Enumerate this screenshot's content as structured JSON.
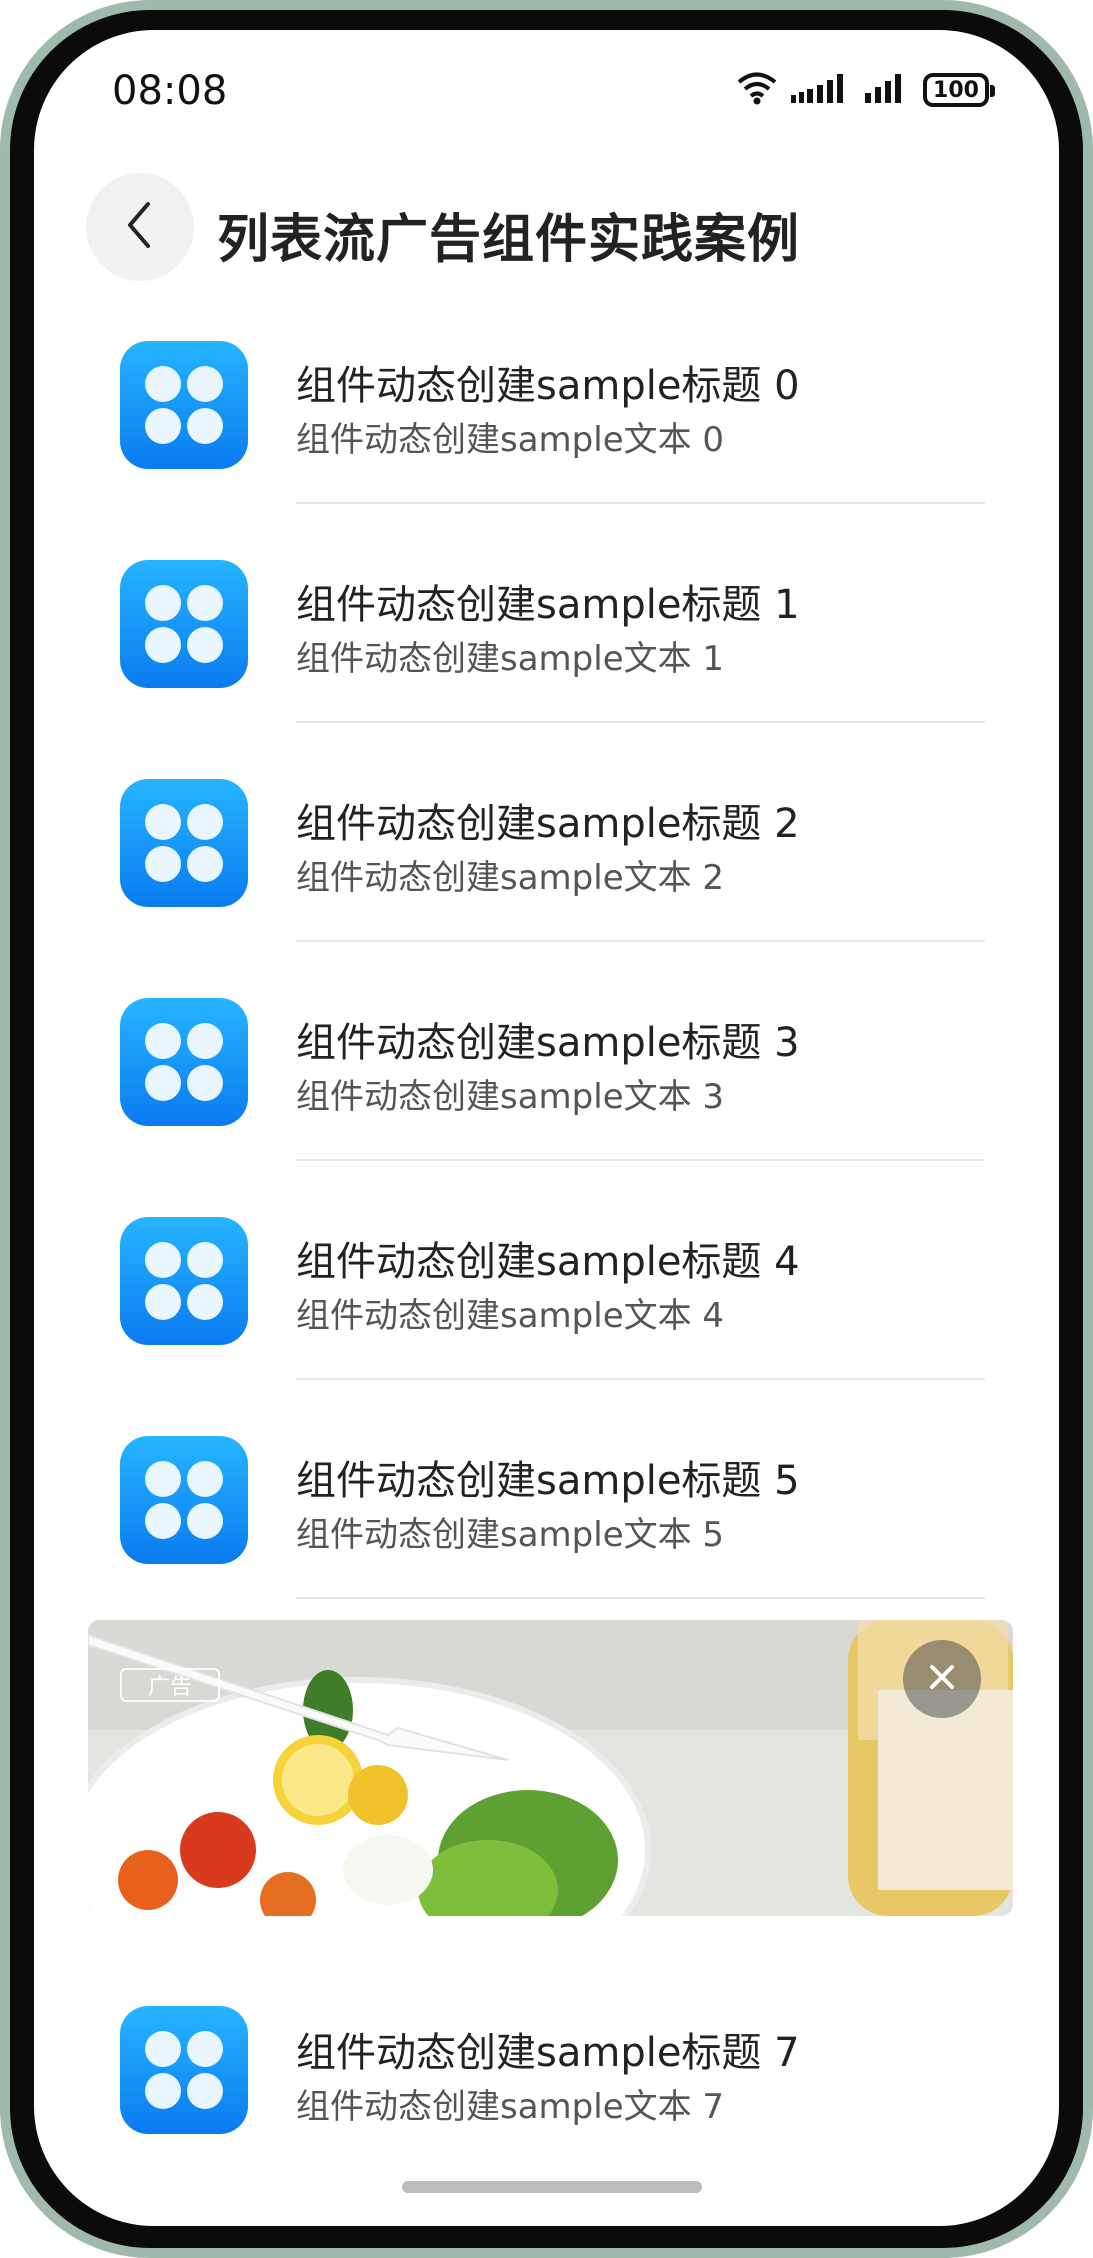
{
  "status_bar": {
    "time": "08:08",
    "battery": "100",
    "icons": [
      "wifi-icon",
      "signal-icon",
      "signal-icon",
      "battery-icon"
    ]
  },
  "header": {
    "title": "列表流广告组件实践案例",
    "back_icon": "chevron-left-icon"
  },
  "list": {
    "items_before_ad": [
      {
        "title": "组件动态创建sample标题 0",
        "subtitle": "组件动态创建sample文本 0"
      },
      {
        "title": "组件动态创建sample标题 1",
        "subtitle": "组件动态创建sample文本 1"
      },
      {
        "title": "组件动态创建sample标题 2",
        "subtitle": "组件动态创建sample文本 2"
      },
      {
        "title": "组件动态创建sample标题 3",
        "subtitle": "组件动态创建sample文本 3"
      },
      {
        "title": "组件动态创建sample标题 4",
        "subtitle": "组件动态创建sample文本 4"
      },
      {
        "title": "组件动态创建sample标题 5",
        "subtitle": "组件动态创建sample文本 5"
      }
    ],
    "items_after_ad": [
      {
        "title": "组件动态创建sample标题 7",
        "subtitle": "组件动态创建sample文本 7"
      }
    ],
    "item_icon": "app-grid-icon"
  },
  "ad": {
    "badge": "广告",
    "close_icon": "close-icon"
  },
  "colors": {
    "icon_gradient_top": "#26b5ff",
    "icon_gradient_bottom": "#0a7bf0",
    "title_text": "#222222",
    "subtitle_text": "#555555"
  }
}
